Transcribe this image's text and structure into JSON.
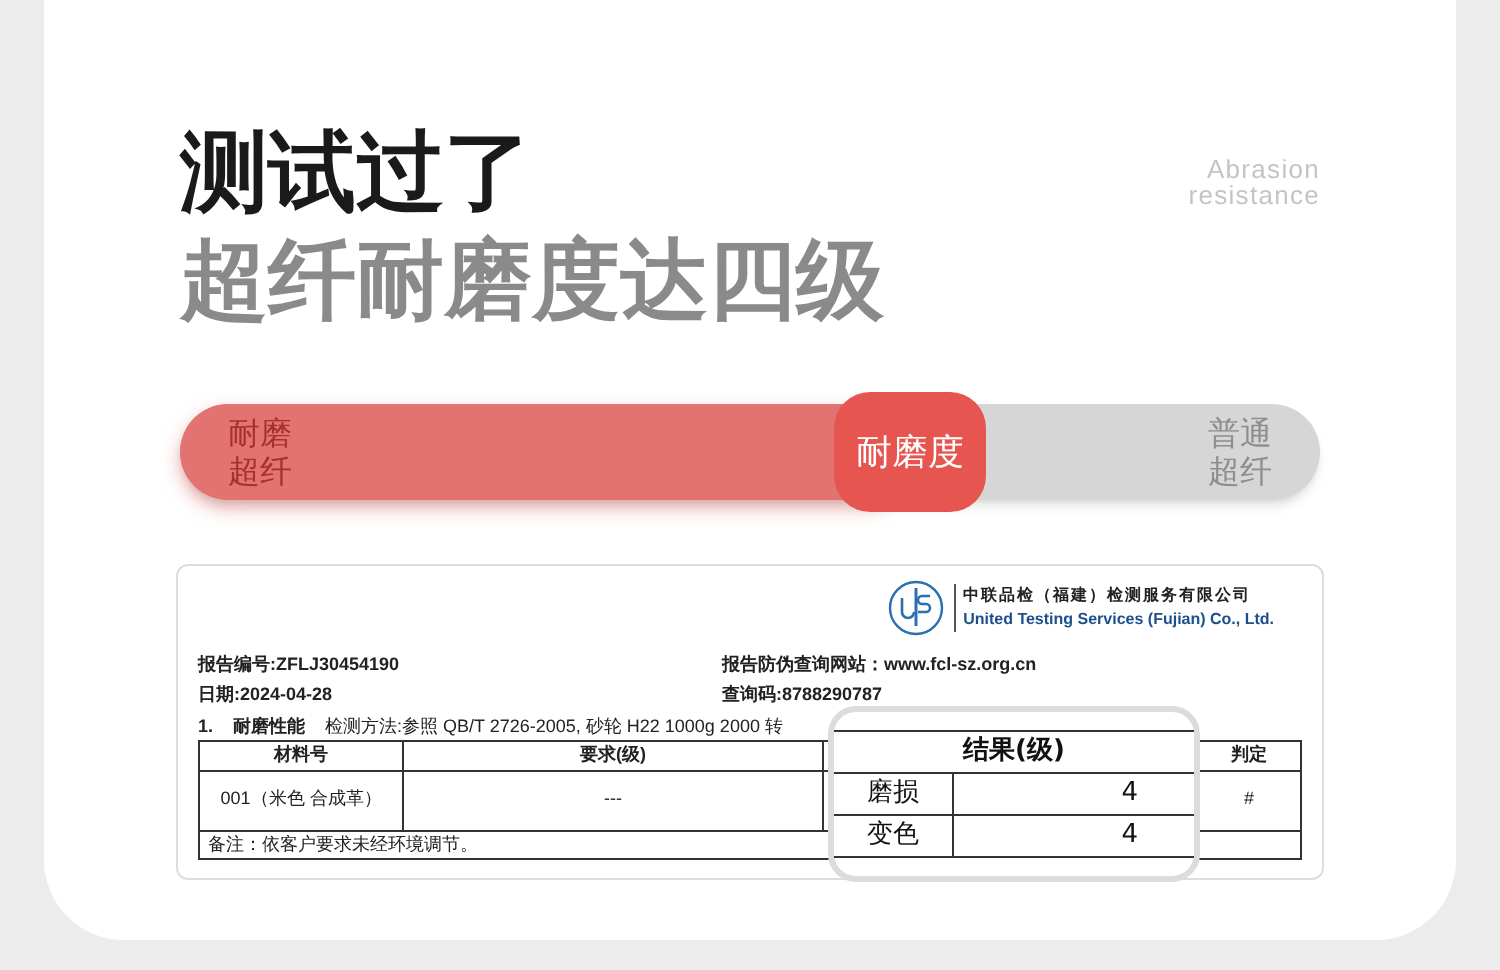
{
  "heading": {
    "line_1": "测试过了",
    "line_2": "超纤耐磨度达四级",
    "caption": [
      "Abrasion",
      "resistance"
    ]
  },
  "comparison_bar": {
    "left_label": [
      "耐磨",
      "超纤"
    ],
    "right_label": [
      "普通",
      "超纤"
    ],
    "badge": "耐磨度",
    "level": 0.64
  },
  "report": {
    "company_cn": "中联品检（福建）检测服务有限公司",
    "company_en": "United Testing Services (Fujian) Co., Ltd.",
    "fields": [
      {
        "label": "报告编号:",
        "value": "ZFLJ30454190"
      },
      {
        "label": "报告防伪查询网站：",
        "value": "www.fcl-sz.org.cn"
      },
      {
        "label": "日期:",
        "value": "2024-04-28"
      },
      {
        "label": "查询码:",
        "value": "8788290787"
      }
    ],
    "section_number": "1.",
    "section_title": "耐磨性能",
    "method": "检测方法:参照 QB/T 2726-2005, 砂轮 H22 1000g 2000 转",
    "columns": [
      "材料号",
      "要求(级)",
      "判定"
    ],
    "row": {
      "material": "001（米色 合成革）",
      "requirement": "---",
      "verdict": "#"
    },
    "note": "备注：依客户要求未经环境调节。",
    "zoom": {
      "title": "结果(级)",
      "rows": [
        {
          "label": "磨损",
          "value": "4"
        },
        {
          "label": "变色",
          "value": "4"
        }
      ]
    }
  }
}
